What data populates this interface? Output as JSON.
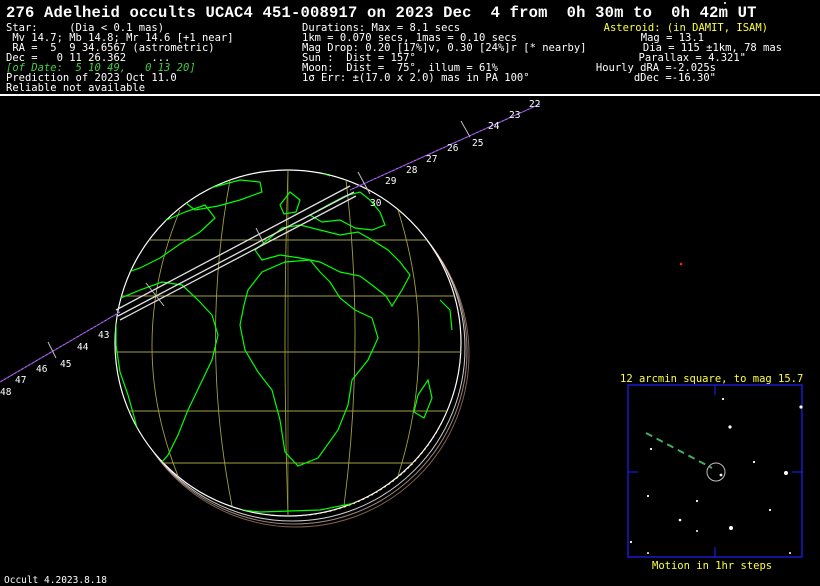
{
  "title": "276 Adelheid occults UCAC4 451-008917 on 2023 Dec  4 from  0h 30m to  0h 42m UT",
  "left_col": [
    "Star:     (Dia < 0.1 mas)",
    " Mv 14.7; Mb 14.8; Mr 14.6 [+1 near]",
    " RA =  5  9 34.6567 (astrometric)",
    "Dec =   0 11 26.362    ...",
    "[of Date:  5 10 49,   0 13 20]",
    "Prediction of 2023 Oct 11.0",
    "Reliable not available"
  ],
  "mid_col": [
    "Durations: Max = 8.1 secs",
    "1km = 0.070 secs, 1mas = 0.10 secs",
    "Mag Drop: 0.20 [17%]v, 0.30 [24%]r [* nearby]",
    "Sun :  Dist = 157°",
    "Moon:  Dist =  75°, illum = 61%",
    "1σ Err: ±(17.0 x 2.0) mas in PA 100°"
  ],
  "right_col": [
    "Asteroid: (in DAMIT, ISAM)",
    "Mag = 13.1",
    "Dia = 115 ±1km, 78 mas",
    "Parallax = 4.321\"",
    "Hourly dRA =-2.025s",
    "dDec =-16.30\""
  ],
  "time_ticks": [
    "22",
    "23",
    "24",
    "25",
    "26",
    "27",
    "28",
    "29",
    "30",
    "43",
    "44",
    "45",
    "46",
    "47",
    "48"
  ],
  "finder": {
    "title": "12 arcmin square, to mag 15.7",
    "footer": "Motion in 1hr steps"
  },
  "footer": "Occult 4.2023.8.18",
  "colors": {
    "background": "#000000",
    "coastline": "#00ff00",
    "grid": "#a0a040",
    "path": "#e0e0e0",
    "track": "#8040c0",
    "label_yellow": "#ffff40",
    "label_green": "#40d040",
    "finder_frame": "#2020ff"
  }
}
